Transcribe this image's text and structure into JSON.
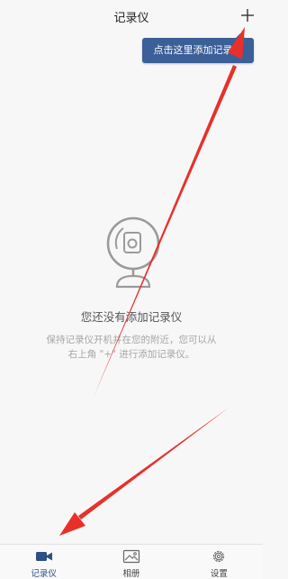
{
  "header": {
    "title": "记录仪",
    "add_icon": "plus-icon"
  },
  "tooltip": {
    "text": "点击这里添加记录仪",
    "color": "#3b5f97"
  },
  "empty_state": {
    "icon": "dashcam-icon",
    "title": "您还没有添加记录仪",
    "description": "保持记录仪开机并在您的附近，您可以从右上角 \"+\" 进行添加记录仪。"
  },
  "tabbar": {
    "active_color": "#2c4f86",
    "tabs": [
      {
        "label": "记录仪",
        "icon": "camera-icon",
        "active": true
      },
      {
        "label": "相册",
        "icon": "photo-icon",
        "active": false
      },
      {
        "label": "设置",
        "icon": "gear-icon",
        "active": false
      }
    ]
  },
  "annotation_color": "#e8302a"
}
